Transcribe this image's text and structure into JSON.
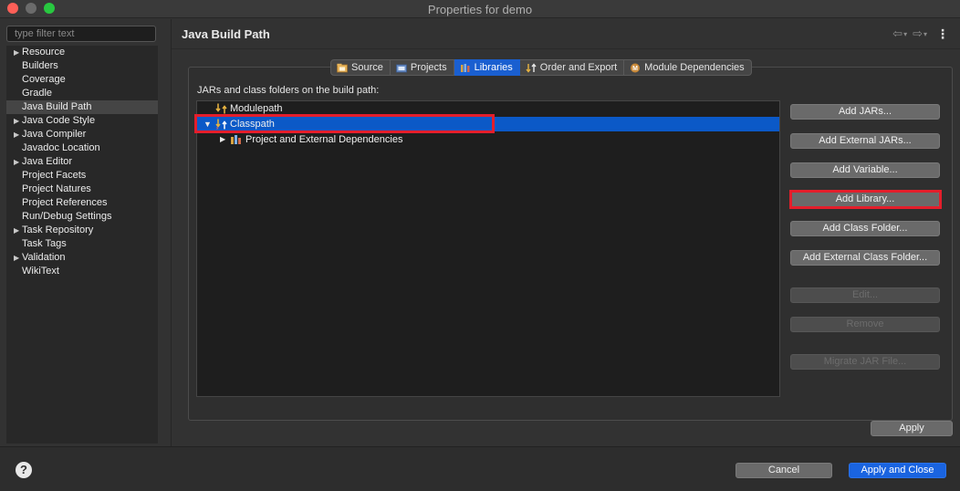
{
  "window": {
    "title": "Properties for demo"
  },
  "sidebar": {
    "filter_placeholder": "type filter text",
    "items": [
      {
        "label": "Resource",
        "expandable": true
      },
      {
        "label": "Builders",
        "expandable": false
      },
      {
        "label": "Coverage",
        "expandable": false
      },
      {
        "label": "Gradle",
        "expandable": false
      },
      {
        "label": "Java Build Path",
        "expandable": false,
        "selected": true
      },
      {
        "label": "Java Code Style",
        "expandable": true
      },
      {
        "label": "Java Compiler",
        "expandable": true
      },
      {
        "label": "Javadoc Location",
        "expandable": false
      },
      {
        "label": "Java Editor",
        "expandable": true
      },
      {
        "label": "Project Facets",
        "expandable": false
      },
      {
        "label": "Project Natures",
        "expandable": false
      },
      {
        "label": "Project References",
        "expandable": false
      },
      {
        "label": "Run/Debug Settings",
        "expandable": false
      },
      {
        "label": "Task Repository",
        "expandable": true
      },
      {
        "label": "Task Tags",
        "expandable": false
      },
      {
        "label": "Validation",
        "expandable": true
      },
      {
        "label": "WikiText",
        "expandable": false
      }
    ]
  },
  "main": {
    "title": "Java Build Path",
    "tabs": [
      {
        "label": "Source",
        "icon": "source-folder-icon"
      },
      {
        "label": "Projects",
        "icon": "projects-icon"
      },
      {
        "label": "Libraries",
        "icon": "libraries-icon",
        "active": true
      },
      {
        "label": "Order and Export",
        "icon": "order-export-icon"
      },
      {
        "label": "Module Dependencies",
        "icon": "module-icon"
      }
    ],
    "panel_label": "JARs and class folders on the build path:",
    "tree": {
      "modulepath": "Modulepath",
      "classpath": "Classpath",
      "dependencies": "Project and External Dependencies"
    },
    "buttons": {
      "add_jars": "Add JARs...",
      "add_external_jars": "Add External JARs...",
      "add_variable": "Add Variable...",
      "add_library": "Add Library...",
      "add_class_folder": "Add Class Folder...",
      "add_external_class_folder": "Add External Class Folder...",
      "edit": "Edit...",
      "remove": "Remove",
      "migrate_jar": "Migrate JAR File..."
    },
    "apply": "Apply"
  },
  "footer": {
    "cancel": "Cancel",
    "apply_and_close": "Apply and Close"
  },
  "colors": {
    "accent": "#1a64e0",
    "highlight": "#e41e2b",
    "selection": "#0b59c7"
  }
}
